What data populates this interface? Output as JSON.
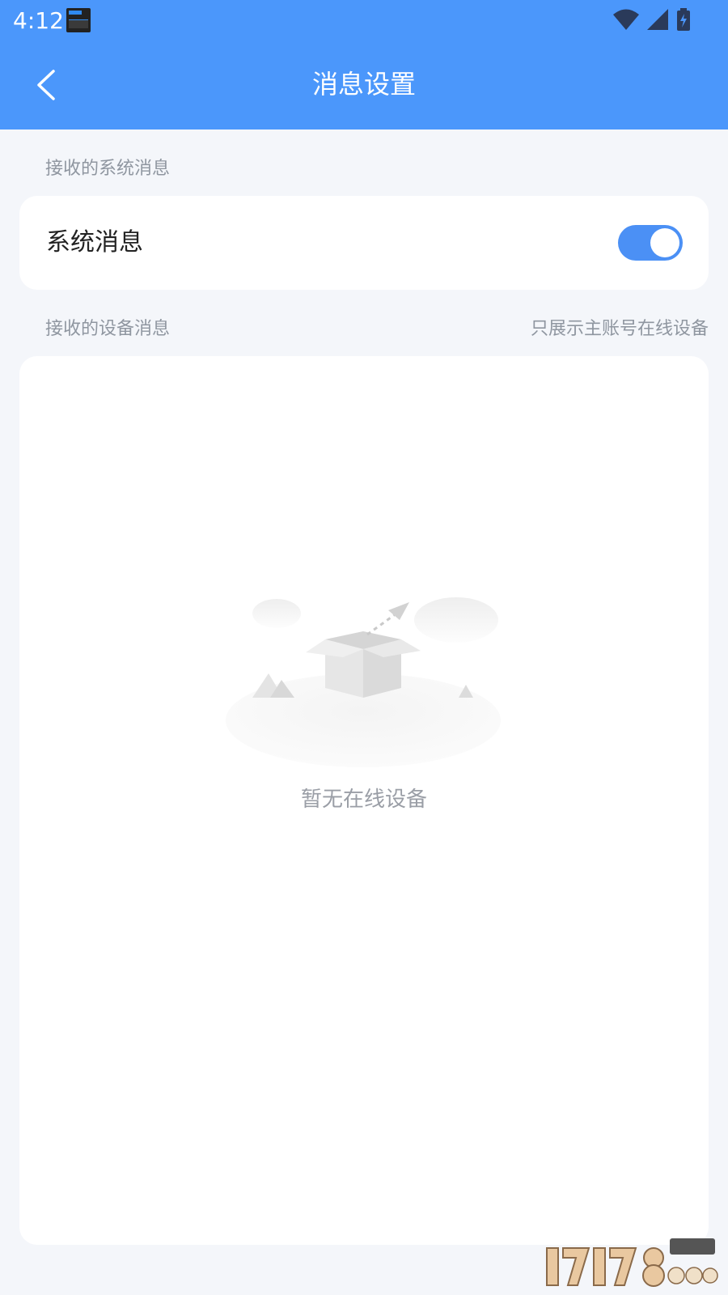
{
  "status_bar": {
    "time": "4:12",
    "icons": [
      "wifi-icon",
      "signal-icon",
      "battery-charging-icon"
    ]
  },
  "header": {
    "title": "消息设置",
    "back_icon": "chevron-left-icon",
    "background": "#4b97fb"
  },
  "system_section": {
    "label": "接收的系统消息",
    "row_title": "系统消息",
    "toggle_on": true,
    "toggle_color": "#4b90f5"
  },
  "device_section": {
    "label": "接收的设备消息",
    "hint": "只展示主账号在线设备",
    "empty_text": "暂无在线设备",
    "empty_icon": "empty-box-icon"
  }
}
